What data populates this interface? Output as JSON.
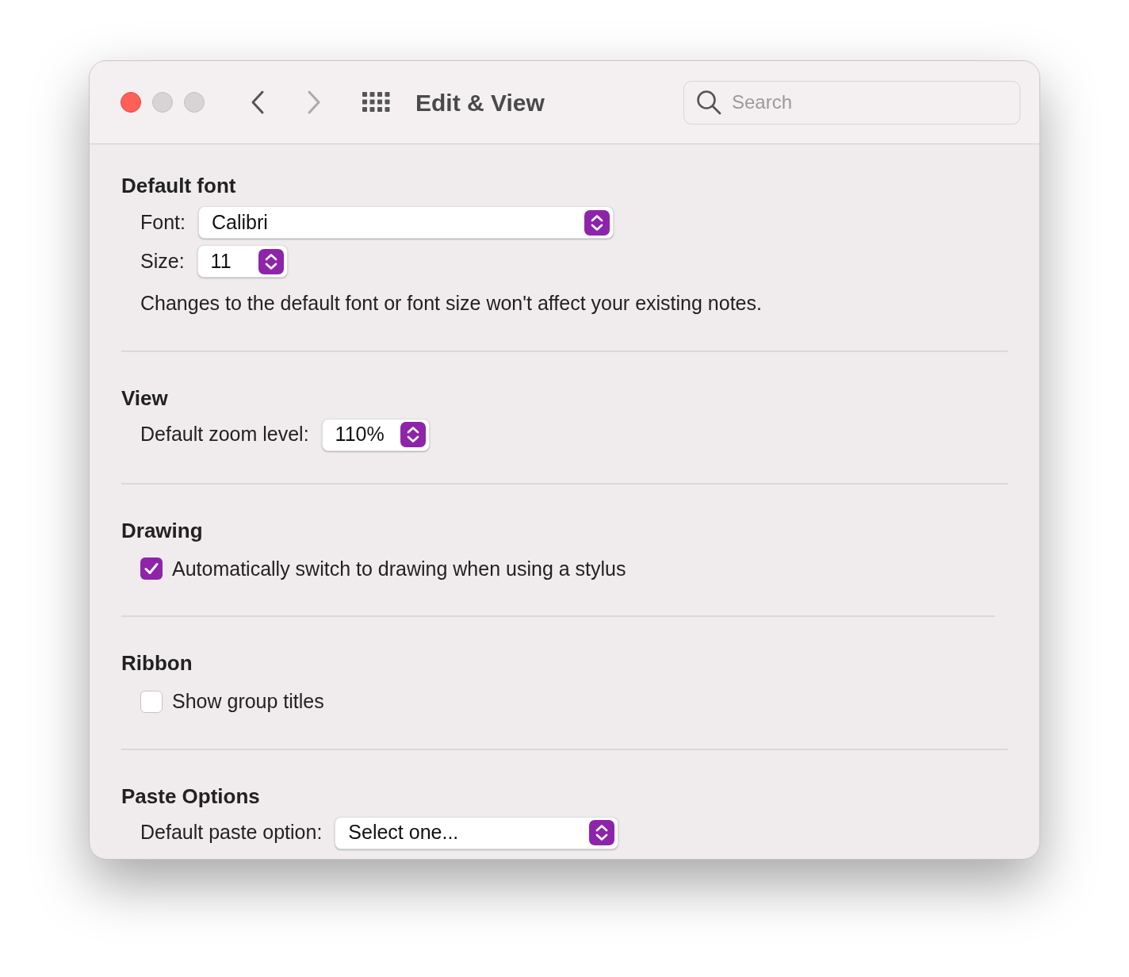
{
  "window": {
    "title": "Edit & View",
    "back_enabled": true,
    "forward_enabled": false
  },
  "search": {
    "placeholder": "Search"
  },
  "sections": [
    {
      "title": "Default font",
      "items": [
        {
          "kind": "select",
          "label": "Font:",
          "value": "Calibri"
        },
        {
          "kind": "select",
          "label": "Size:",
          "value": "11"
        },
        {
          "kind": "note",
          "text": "Changes to the default font or font size won't affect your existing notes."
        }
      ]
    },
    {
      "title": "View",
      "items": [
        {
          "kind": "select",
          "label": "Default zoom level:",
          "value": "110%"
        }
      ]
    },
    {
      "title": "Drawing",
      "items": [
        {
          "kind": "checkbox",
          "label": "Automatically switch to drawing when using a stylus",
          "checked": true
        }
      ]
    },
    {
      "title": "Ribbon",
      "items": [
        {
          "kind": "checkbox",
          "label": "Show group titles",
          "checked": false
        }
      ]
    },
    {
      "title": "Paste Options",
      "items": [
        {
          "kind": "select",
          "label": "Default paste option:",
          "value": "Select one..."
        }
      ]
    }
  ]
}
